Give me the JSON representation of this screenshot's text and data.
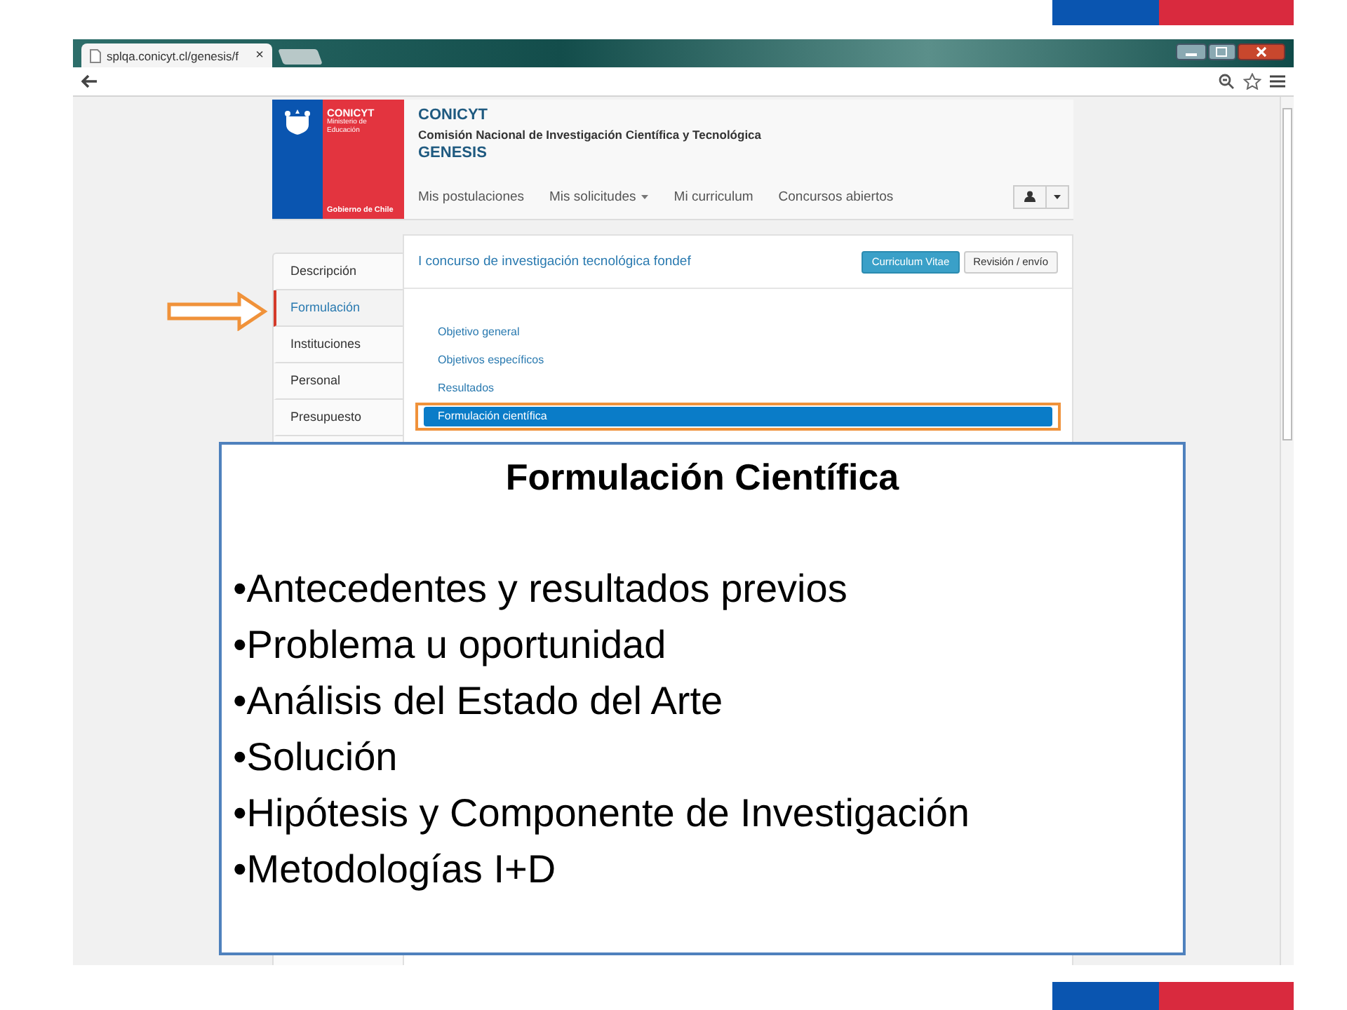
{
  "browser": {
    "tab_title": "splqa.conicyt.cl/genesis/f",
    "tab_close": "×"
  },
  "site": {
    "logo": {
      "name": "CONICYT",
      "ministry": "Ministerio de Educación",
      "government": "Gobierno de Chile"
    },
    "title": "CONICYT",
    "subtitle": "Comisión Nacional de Investigación Científica y Tecnológica",
    "app": "GENESIS"
  },
  "nav": [
    {
      "label": "Mis postulaciones",
      "dropdown": false
    },
    {
      "label": "Mis solicitudes",
      "dropdown": true
    },
    {
      "label": "Mi curriculum",
      "dropdown": false
    },
    {
      "label": "Concursos abiertos",
      "dropdown": false
    }
  ],
  "sidebar": {
    "items": [
      {
        "label": "Descripción",
        "selected": false
      },
      {
        "label": "Formulación",
        "selected": true
      },
      {
        "label": "Instituciones",
        "selected": false
      },
      {
        "label": "Personal",
        "selected": false
      },
      {
        "label": "Presupuesto",
        "selected": false
      }
    ]
  },
  "panel": {
    "title": "I concurso de investigación tecnológica fondef",
    "buttons": [
      {
        "label": "Curriculum Vitae",
        "kind": "primary"
      },
      {
        "label": "Revisión / envío",
        "kind": "default"
      }
    ],
    "links": [
      {
        "label": "Objetivo general",
        "selected": false,
        "highlighted": false
      },
      {
        "label": "Objetivos específicos",
        "selected": false,
        "highlighted": false
      },
      {
        "label": "Resultados",
        "selected": false,
        "highlighted": false
      },
      {
        "label": "Formulación científica",
        "selected": true,
        "highlighted": true
      }
    ]
  },
  "callout": {
    "title": "Formulación Científica",
    "bullets": [
      "•Antecedentes y resultados previos",
      "•Problema u oportunidad",
      "•Análisis del Estado del Arte",
      "•Solución",
      "•Hipótesis y Componente de Investigación",
      "•Metodologías I+D"
    ]
  }
}
